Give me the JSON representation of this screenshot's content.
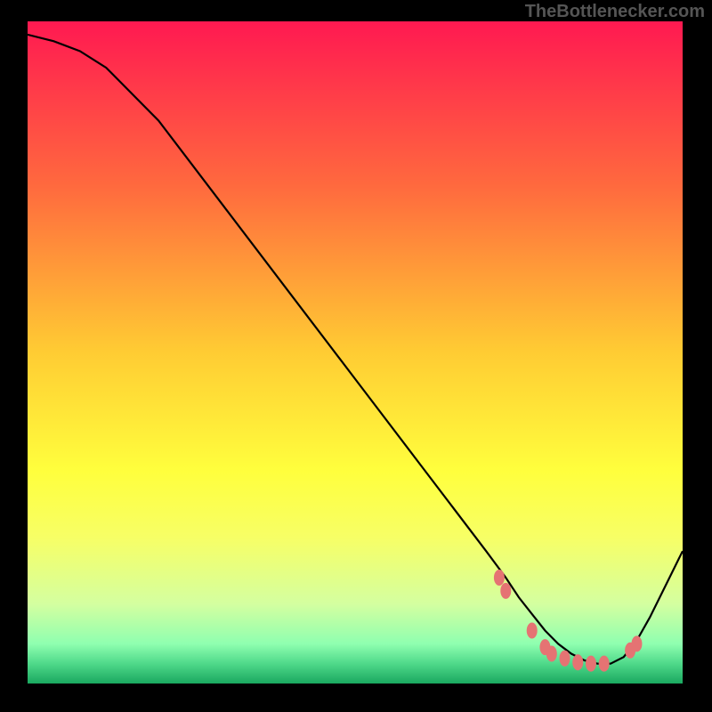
{
  "watermark": "TheBottlenecker.com",
  "chart_data": {
    "type": "line",
    "title": "",
    "xlabel": "",
    "ylabel": "",
    "xlim": [
      0,
      100
    ],
    "ylim": [
      0,
      100
    ],
    "series": [
      {
        "name": "curve",
        "color": "#000000",
        "x": [
          0,
          4,
          8,
          12,
          20,
          30,
          40,
          50,
          60,
          70,
          73,
          75,
          77,
          79,
          81,
          83,
          85,
          87,
          89,
          91,
          93,
          95,
          100
        ],
        "y": [
          98,
          97,
          95.5,
          93,
          85,
          72,
          59,
          46,
          33,
          20,
          16,
          13,
          10.5,
          8,
          6,
          4.5,
          3.5,
          3,
          3,
          4,
          6.5,
          10,
          20
        ]
      },
      {
        "name": "markers",
        "color": "#e57373",
        "type": "scatter",
        "x": [
          72,
          73,
          77,
          79,
          80,
          82,
          84,
          86,
          88,
          92,
          93
        ],
        "y": [
          16,
          14,
          8,
          5.5,
          4.5,
          3.8,
          3.2,
          3,
          3,
          5,
          6
        ]
      }
    ],
    "gradient_stops": [
      {
        "offset": 0.0,
        "color": "#ff1951"
      },
      {
        "offset": 0.25,
        "color": "#ff6a3e"
      },
      {
        "offset": 0.5,
        "color": "#ffcc33"
      },
      {
        "offset": 0.68,
        "color": "#ffff3d"
      },
      {
        "offset": 0.78,
        "color": "#f7ff66"
      },
      {
        "offset": 0.88,
        "color": "#d4ffa0"
      },
      {
        "offset": 0.94,
        "color": "#8fffb0"
      },
      {
        "offset": 0.97,
        "color": "#4fd98a"
      },
      {
        "offset": 1.0,
        "color": "#1aa85f"
      }
    ]
  }
}
